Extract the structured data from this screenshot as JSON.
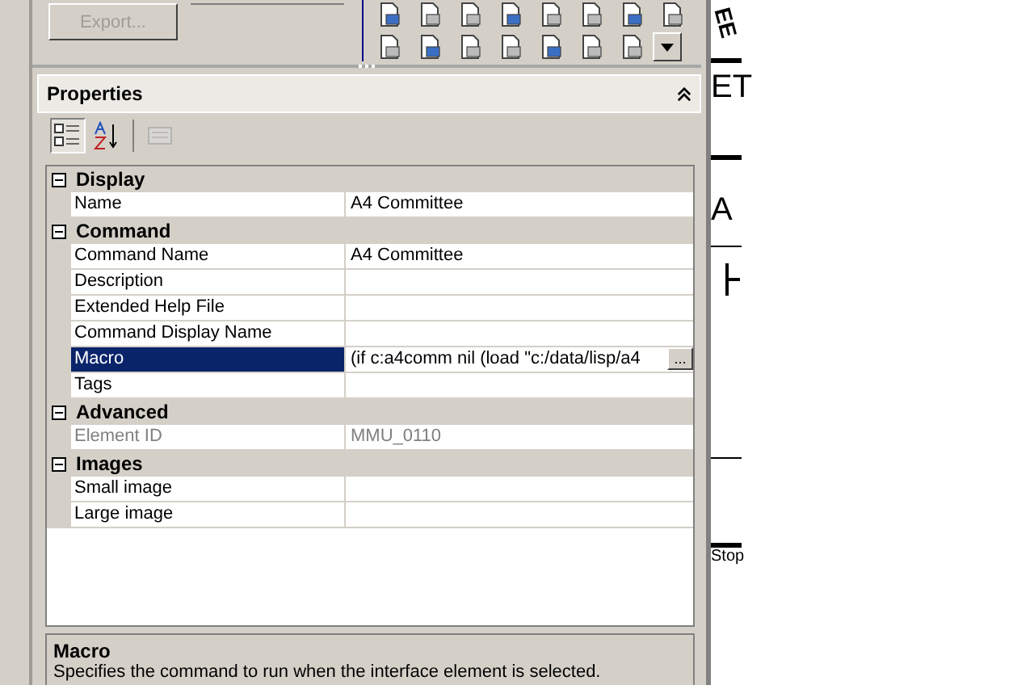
{
  "top": {
    "export_button": {
      "label": "Export...",
      "disabled": true
    }
  },
  "properties": {
    "title": "Properties",
    "toolbar": [
      {
        "kind": "categorized",
        "selected": true
      },
      {
        "kind": "alphabetic",
        "selected": false
      },
      {
        "kind": "pages",
        "selected": false,
        "disabled": true
      }
    ],
    "categories": [
      {
        "name": "Display",
        "expanded": true,
        "rows": [
          {
            "name": "Name",
            "value": "A4 Committee",
            "selected": false,
            "disabled": false
          }
        ]
      },
      {
        "name": "Command",
        "expanded": true,
        "rows": [
          {
            "name": "Command Name",
            "value": "A4 Committee",
            "selected": false,
            "disabled": false
          },
          {
            "name": "Description",
            "selected": false,
            "disabled": false
          },
          {
            "name": "Extended Help File",
            "selected": false,
            "disabled": false
          },
          {
            "name": "Command Display Name",
            "selected": false,
            "disabled": false
          },
          {
            "name": "Macro",
            "value": "(if c:a4comm nil (load \"c:/data/lisp/a4",
            "selected": true,
            "disabled": false,
            "browse": "..."
          },
          {
            "name": "Tags",
            "selected": false,
            "disabled": false
          }
        ]
      },
      {
        "name": "Advanced",
        "expanded": true,
        "rows": [
          {
            "name": "Element ID",
            "value": "MMU_0110",
            "selected": false,
            "disabled": true
          }
        ]
      },
      {
        "name": "Images",
        "expanded": true,
        "rows": [
          {
            "name": "Small image",
            "selected": false,
            "disabled": false
          },
          {
            "name": "Large image",
            "selected": false,
            "disabled": false
          }
        ]
      }
    ],
    "description": {
      "title": "Macro",
      "text": "Specifies the command to run when the interface element is selected."
    }
  },
  "drawing": {
    "texts": [
      "EE",
      "ET",
      "A",
      "Stop"
    ]
  }
}
